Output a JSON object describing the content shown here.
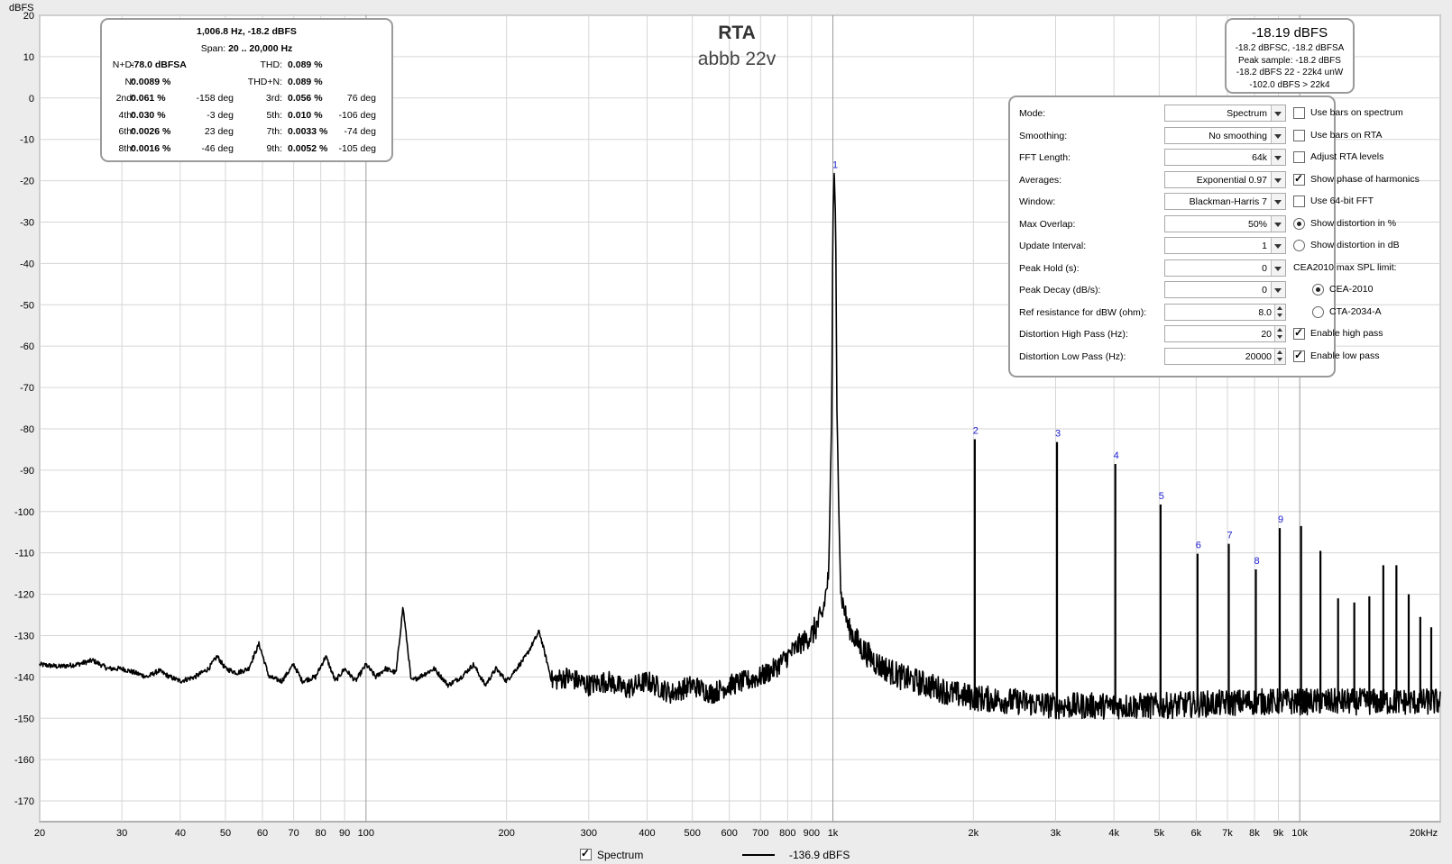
{
  "chart_data": {
    "type": "line",
    "title": "RTA",
    "subtitle": "abbb 22v",
    "ylabel": "dBFS",
    "xscale": "log",
    "xlim": [
      20,
      20000
    ],
    "ylim": [
      -175,
      20
    ],
    "grid": true,
    "x_tick_values": [
      20,
      30,
      40,
      50,
      60,
      70,
      80,
      90,
      100,
      200,
      300,
      400,
      500,
      600,
      700,
      800,
      900,
      1000,
      2000,
      3000,
      4000,
      5000,
      6000,
      7000,
      8000,
      9000,
      10000,
      20000
    ],
    "x_tick_labels": [
      "20",
      "30",
      "40",
      "50",
      "60",
      "70",
      "80",
      "90",
      "100",
      "200",
      "300",
      "400",
      "500",
      "600",
      "700",
      "800",
      "900",
      "1k",
      "2k",
      "3k",
      "4k",
      "5k",
      "6k",
      "7k",
      "8k",
      "9k",
      "10k",
      "20kHz"
    ],
    "y_tick_values": [
      20,
      10,
      0,
      -10,
      -20,
      -30,
      -40,
      -50,
      -60,
      -70,
      -80,
      -90,
      -100,
      -110,
      -120,
      -130,
      -140,
      -150,
      -160,
      -170
    ],
    "y_tick_labels": [
      "20",
      "10",
      "0",
      "-10",
      "-20",
      "-30",
      "-40",
      "-50",
      "-60",
      "-70",
      "-80",
      "-90",
      "-100",
      "-110",
      "-120",
      "-130",
      "-140",
      "-150",
      "-160",
      "-170"
    ],
    "series": [
      {
        "name": "Spectrum",
        "color": "#000000",
        "floor": [
          [
            20,
            -137
          ],
          [
            22,
            -137.5
          ],
          [
            24,
            -137
          ],
          [
            26,
            -136
          ],
          [
            28,
            -138
          ],
          [
            30,
            -138
          ],
          [
            32,
            -139
          ],
          [
            34,
            -140
          ],
          [
            36,
            -138.5
          ],
          [
            38,
            -140
          ],
          [
            40,
            -141
          ],
          [
            43,
            -140
          ],
          [
            46,
            -138
          ],
          [
            48,
            -135
          ],
          [
            50,
            -138
          ],
          [
            53,
            -139
          ],
          [
            56,
            -138
          ],
          [
            59,
            -132
          ],
          [
            62,
            -140
          ],
          [
            66,
            -141
          ],
          [
            70,
            -137
          ],
          [
            73,
            -141
          ],
          [
            78,
            -140
          ],
          [
            82,
            -135
          ],
          [
            86,
            -141
          ],
          [
            90,
            -138
          ],
          [
            95,
            -141
          ],
          [
            100,
            -137
          ],
          [
            105,
            -140
          ],
          [
            110,
            -138
          ],
          [
            116,
            -139
          ],
          [
            120,
            -123
          ],
          [
            125,
            -141
          ],
          [
            130,
            -140
          ],
          [
            140,
            -138
          ],
          [
            150,
            -142
          ],
          [
            160,
            -140
          ],
          [
            170,
            -137
          ],
          [
            180,
            -142
          ],
          [
            190,
            -138
          ],
          [
            200,
            -141
          ],
          [
            210,
            -138
          ],
          [
            220,
            -135
          ],
          [
            235,
            -129
          ],
          [
            250,
            -141
          ],
          [
            270,
            -140
          ],
          [
            300,
            -142
          ],
          [
            330,
            -141
          ],
          [
            360,
            -143
          ],
          [
            400,
            -141
          ],
          [
            450,
            -144
          ],
          [
            500,
            -142
          ],
          [
            550,
            -144
          ],
          [
            600,
            -142
          ],
          [
            650,
            -141
          ],
          [
            700,
            -140
          ],
          [
            750,
            -138
          ],
          [
            800,
            -135
          ],
          [
            850,
            -132
          ],
          [
            900,
            -130
          ],
          [
            950,
            -125
          ],
          [
            980,
            -115
          ],
          [
            995,
            -75
          ],
          [
            1000,
            -30
          ],
          [
            1006.8,
            -18.2
          ],
          [
            1014,
            -30
          ],
          [
            1020,
            -75
          ],
          [
            1040,
            -120
          ],
          [
            1080,
            -128
          ],
          [
            1150,
            -133
          ],
          [
            1250,
            -137
          ],
          [
            1400,
            -140
          ],
          [
            1600,
            -142
          ],
          [
            1800,
            -144
          ],
          [
            2000,
            -145
          ],
          [
            2500,
            -146
          ],
          [
            3000,
            -147
          ],
          [
            5000,
            -147
          ],
          [
            8000,
            -146
          ],
          [
            12000,
            -146
          ],
          [
            20000,
            -146
          ]
        ],
        "peaks": [
          {
            "label": "1",
            "freq": 1006.8,
            "db": -18.2
          },
          {
            "label": "2",
            "freq": 2013.6,
            "db": -82.5
          },
          {
            "label": "3",
            "freq": 3020.4,
            "db": -83.2
          },
          {
            "label": "4",
            "freq": 4027.2,
            "db": -88.5
          },
          {
            "label": "5",
            "freq": 5034.0,
            "db": -98.3
          },
          {
            "label": "6",
            "freq": 6040.8,
            "db": -110.2
          },
          {
            "label": "7",
            "freq": 7047.6,
            "db": -107.8
          },
          {
            "label": "8",
            "freq": 8054.4,
            "db": -114
          },
          {
            "label": "9",
            "freq": 9061.2,
            "db": -104
          },
          {
            "label": "",
            "freq": 10068,
            "db": -103.5
          },
          {
            "label": "",
            "freq": 11075,
            "db": -109.5
          },
          {
            "label": "",
            "freq": 12082,
            "db": -121
          },
          {
            "label": "",
            "freq": 13088,
            "db": -122
          },
          {
            "label": "",
            "freq": 14095,
            "db": -120.5
          },
          {
            "label": "",
            "freq": 15102,
            "db": -113
          },
          {
            "label": "",
            "freq": 16109,
            "db": -113
          },
          {
            "label": "",
            "freq": 17116,
            "db": -120
          },
          {
            "label": "",
            "freq": 18122,
            "db": -125.5
          },
          {
            "label": "",
            "freq": 19129,
            "db": -128
          }
        ]
      }
    ]
  },
  "stats": {
    "header1": "1,006.8 Hz, -18.2 dBFS",
    "span_label": "Span:",
    "span_value": "20 .. 20,000 Hz",
    "rows": [
      {
        "l1": "N+D:",
        "v1": "-78.0 dBFSA",
        "p1": "",
        "l2": "THD:",
        "v2": "0.089 %",
        "p2": ""
      },
      {
        "l1": "N:",
        "v1": "0.0089 %",
        "p1": "",
        "l2": "THD+N:",
        "v2": "0.089 %",
        "p2": ""
      },
      {
        "l1": "2nd:",
        "v1": "0.061 %",
        "p1": "-158 deg",
        "l2": "3rd:",
        "v2": "0.056 %",
        "p2": "76 deg"
      },
      {
        "l1": "4th:",
        "v1": "0.030 %",
        "p1": "-3 deg",
        "l2": "5th:",
        "v2": "0.010 %",
        "p2": "-106 deg"
      },
      {
        "l1": "6th:",
        "v1": "0.0026 %",
        "p1": "23 deg",
        "l2": "7th:",
        "v2": "0.0033 %",
        "p2": "-74 deg"
      },
      {
        "l1": "8th:",
        "v1": "0.0016 %",
        "p1": "-46 deg",
        "l2": "9th:",
        "v2": "0.0052 %",
        "p2": "-105 deg"
      }
    ]
  },
  "level": {
    "big": "-18.19 dBFS",
    "lines": [
      "-18.2 dBFSC, -18.2 dBFSA",
      "Peak sample: -18.2 dBFS",
      "-18.2 dBFS 22 - 22k4 unW",
      "-102.0 dBFS > 22k4"
    ]
  },
  "settings": {
    "rows": [
      {
        "label": "Mode:",
        "value": "Spectrum",
        "kind": "dd"
      },
      {
        "label": "Smoothing:",
        "value": "No  smoothing",
        "kind": "dd"
      },
      {
        "label": "FFT Length:",
        "value": "64k",
        "kind": "dd"
      },
      {
        "label": "Averages:",
        "value": "Exponential 0.97",
        "kind": "dd"
      },
      {
        "label": "Window:",
        "value": "Blackman-Harris 7",
        "kind": "dd"
      },
      {
        "label": "Max Overlap:",
        "value": "50%",
        "kind": "dd"
      },
      {
        "label": "Update Interval:",
        "value": "1",
        "kind": "dd"
      },
      {
        "label": "Peak Hold (s):",
        "value": "0",
        "kind": "dd"
      },
      {
        "label": "Peak Decay (dB/s):",
        "value": "0",
        "kind": "dd"
      },
      {
        "label": "Ref resistance for dBW (ohm):",
        "value": "8.0",
        "kind": "spin"
      },
      {
        "label": "Distortion High Pass (Hz):",
        "value": "20",
        "kind": "spin"
      },
      {
        "label": "Distortion Low Pass (Hz):",
        "value": "20000",
        "kind": "spin"
      }
    ],
    "options": [
      {
        "type": "check",
        "label": "Use bars on spectrum",
        "checked": false
      },
      {
        "type": "check",
        "label": "Use bars on RTA",
        "checked": false
      },
      {
        "type": "check",
        "label": "Adjust RTA levels",
        "checked": false
      },
      {
        "type": "check",
        "label": "Show phase of harmonics",
        "checked": true
      },
      {
        "type": "check",
        "label": "Use 64-bit FFT",
        "checked": false
      },
      {
        "type": "radio",
        "label": "Show distortion in %",
        "checked": true
      },
      {
        "type": "radio",
        "label": "Show distortion in dB",
        "checked": false
      },
      {
        "type": "text",
        "label": "CEA2010 max SPL limit:",
        "checked": false
      },
      {
        "type": "radio",
        "label": "CEA-2010",
        "checked": true,
        "indent": true
      },
      {
        "type": "radio",
        "label": "CTA-2034-A",
        "checked": false,
        "indent": true
      },
      {
        "type": "check",
        "label": "Enable high pass",
        "checked": true
      },
      {
        "type": "check",
        "label": "Enable low pass",
        "checked": true
      }
    ]
  },
  "legend": {
    "label": "Spectrum",
    "checked": true,
    "value": "-136.9 dBFS"
  }
}
